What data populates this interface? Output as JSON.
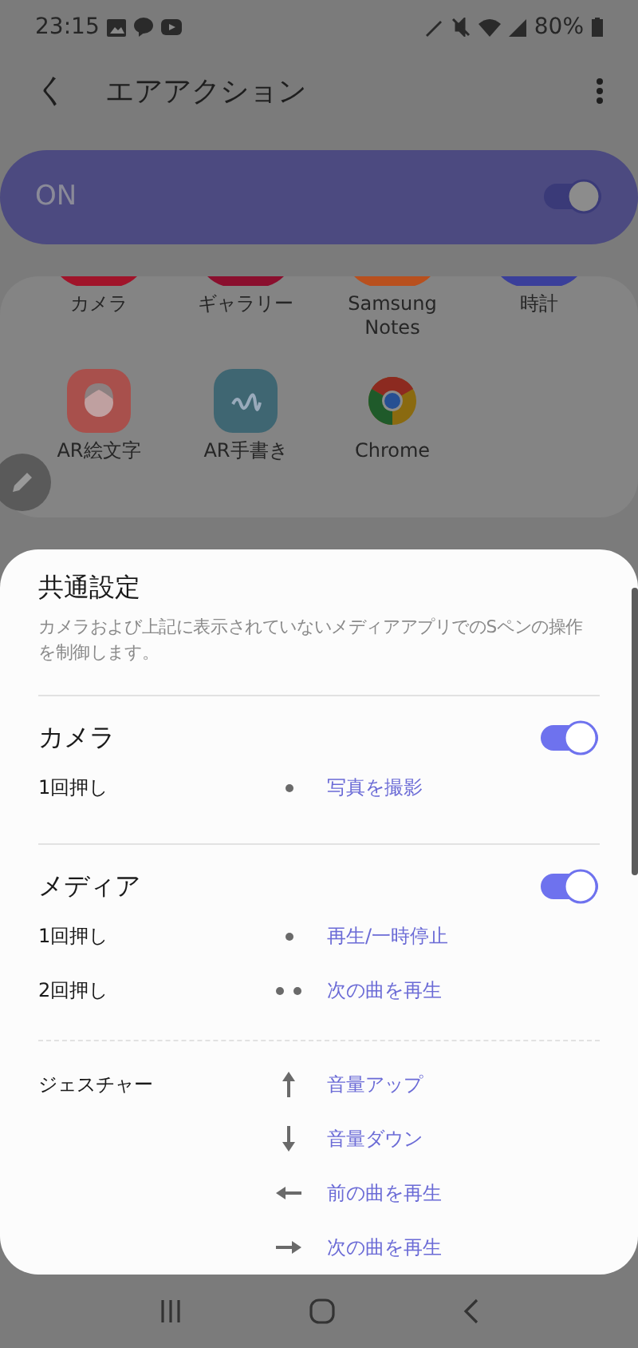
{
  "status_bar": {
    "time": "23:15",
    "battery": "80%"
  },
  "header": {
    "back": "く",
    "title": "エアアクション"
  },
  "master": {
    "label": "ON",
    "on": true
  },
  "apps": [
    {
      "label": "カメラ",
      "kind": "cut",
      "color": "#a0142a"
    },
    {
      "label": "ギャラリー",
      "kind": "cut",
      "color": "#8a0f2e"
    },
    {
      "label": "Samsung Notes",
      "kind": "cut",
      "color": "#b8501e"
    },
    {
      "label": "時計",
      "kind": "cut",
      "color": "#3a3f9a"
    },
    {
      "label": "AR絵文字",
      "kind": "face"
    },
    {
      "label": "AR手書き",
      "kind": "squiggle"
    },
    {
      "label": "Chrome",
      "kind": "chrome"
    }
  ],
  "sheet": {
    "title": "共通設定",
    "description": "カメラおよび上記に表示されていないメディアアプリでのSペンの操作を制御します。",
    "sections": [
      {
        "title": "カメラ",
        "on": true,
        "actions": [
          {
            "trigger": "1回押し",
            "kind": "single",
            "action": "写真を撮影"
          }
        ]
      },
      {
        "title": "メディア",
        "on": true,
        "actions": [
          {
            "trigger": "1回押し",
            "kind": "single",
            "action": "再生/一時停止"
          },
          {
            "trigger": "2回押し",
            "kind": "double",
            "action": "次の曲を再生"
          }
        ]
      }
    ],
    "gestures": {
      "label": "ジェスチャー",
      "actions": [
        {
          "kind": "up",
          "action": "音量アップ"
        },
        {
          "kind": "down",
          "action": "音量ダウン"
        },
        {
          "kind": "left",
          "action": "前の曲を再生"
        },
        {
          "kind": "right",
          "action": "次の曲を再生"
        }
      ]
    }
  }
}
